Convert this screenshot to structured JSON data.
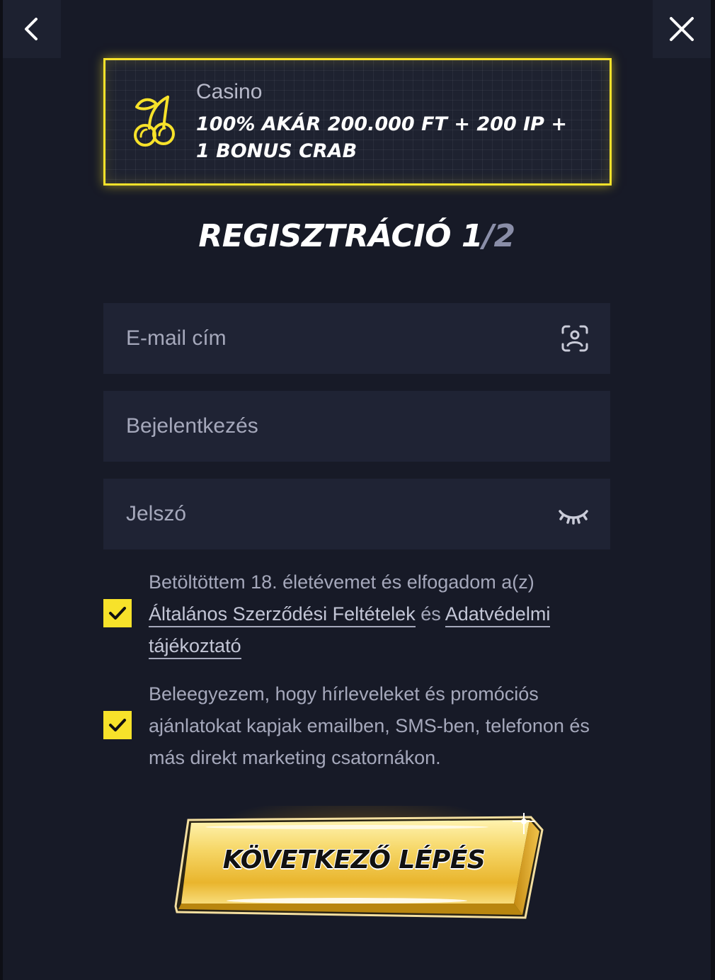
{
  "header": {
    "back_icon": "chevron-left-icon",
    "close_icon": "close-icon"
  },
  "promo": {
    "icon": "cherries-icon",
    "category": "Casino",
    "offer": "100% AKÁR 200.000 FT + 200 IP + 1 BONUS CRAB",
    "accent_color": "#f7e22a"
  },
  "title": {
    "main": "REGISZTRÁCIÓ 1",
    "separator": "/",
    "total": "2"
  },
  "form": {
    "email": {
      "placeholder": "E-mail cím",
      "value": "",
      "icon": "face-scan-icon"
    },
    "login": {
      "placeholder": "Bejelentkezés",
      "value": ""
    },
    "password": {
      "placeholder": "Jelszó",
      "value": "",
      "icon": "eye-closed-icon"
    }
  },
  "consents": {
    "terms": {
      "checked": true,
      "text_before": "Betöltöttem 18. életévemet és elfogadom a(z) ",
      "link_terms": "Általános Szerződési Feltételek",
      "text_and": " és ",
      "link_privacy": "Adatvédelmi tájékoztató"
    },
    "marketing": {
      "checked": true,
      "text": "Beleegyezem, hogy hírleveleket és promóciós ajánlatokat kapjak emailben, SMS-ben, telefonon és más direkt marketing csatornákon."
    }
  },
  "cta": {
    "label": "KÖVETKEZŐ LÉPÉS",
    "color": "#f2c43a"
  }
}
